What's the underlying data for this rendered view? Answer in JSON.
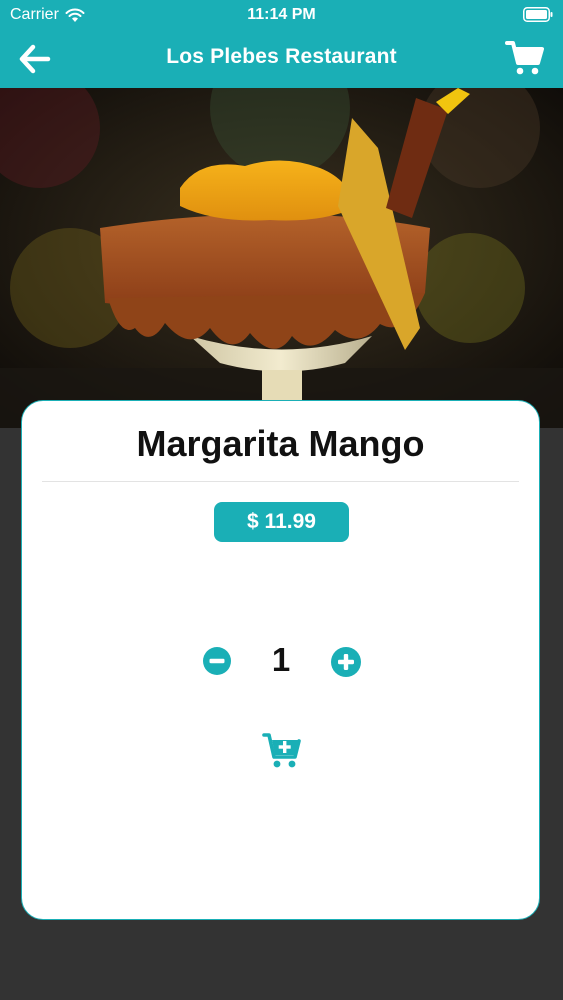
{
  "status_bar": {
    "carrier": "Carrier",
    "time": "11:14 PM"
  },
  "nav": {
    "title": "Los Plebes Restaurant",
    "back_icon": "arrow-left-icon",
    "cart_icon": "cart-icon"
  },
  "product": {
    "name": "Margarita Mango",
    "price": "$ 11.99",
    "quantity": "1",
    "decrease_icon": "minus-circle-icon",
    "increase_icon": "plus-circle-icon",
    "add_to_cart_icon": "cart-plus-icon"
  },
  "colors": {
    "accent": "#1aafb6",
    "background": "#333333",
    "card": "#ffffff"
  }
}
